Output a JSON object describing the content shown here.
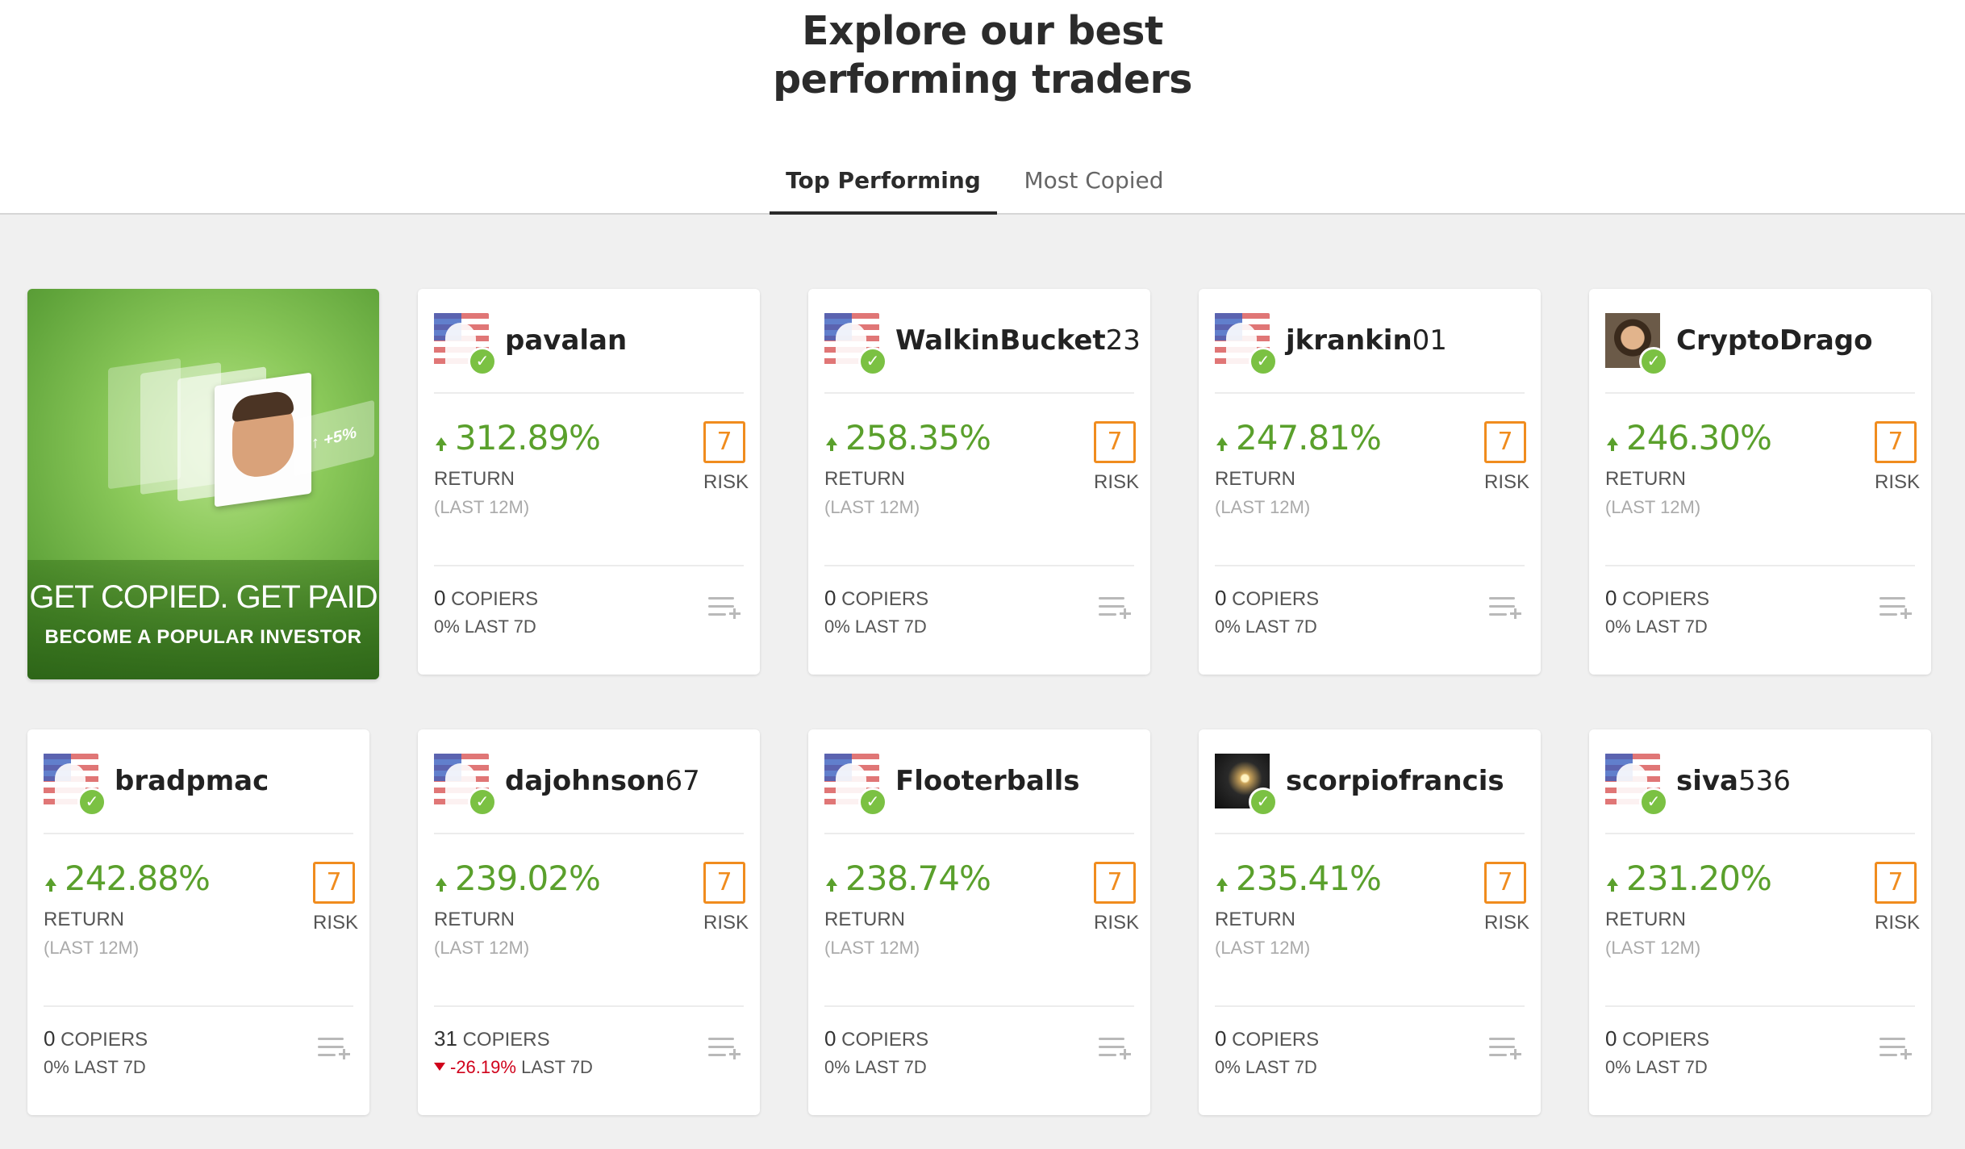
{
  "header": {
    "headline_line1": "Explore our best",
    "headline_line2": "performing traders"
  },
  "tabs": [
    {
      "label": "Top Performing",
      "active": true
    },
    {
      "label": "Most Copied",
      "active": false
    }
  ],
  "promo": {
    "title": "GET COPIED. GET PAID",
    "subtitle": "BECOME A POPULAR INVESTOR",
    "tag": "+5%"
  },
  "labels": {
    "return": "RETURN",
    "period": "(LAST 12M)",
    "risk": "RISK",
    "copiers": "COPIERS",
    "last7": "LAST 7D"
  },
  "colors": {
    "positive": "#5aa02c",
    "negative": "#d0021b",
    "risk": "#f08c1e",
    "verified": "#7bc143"
  },
  "traders": [
    {
      "name_bold": "pavalan",
      "name_regular": "",
      "avatar": "flag-default",
      "return": "312.89%",
      "risk": "7",
      "copiers": "0",
      "last7": "0%",
      "last7_negative": false
    },
    {
      "name_bold": "WalkinBucket",
      "name_regular": "23",
      "avatar": "flag-default",
      "return": "258.35%",
      "risk": "7",
      "copiers": "0",
      "last7": "0%",
      "last7_negative": false
    },
    {
      "name_bold": "jkrankin",
      "name_regular": "01",
      "avatar": "flag-default",
      "return": "247.81%",
      "risk": "7",
      "copiers": "0",
      "last7": "0%",
      "last7_negative": false
    },
    {
      "name_bold": "CryptoDrago",
      "name_regular": "",
      "avatar": "photo-portrait",
      "return": "246.30%",
      "risk": "7",
      "copiers": "0",
      "last7": "0%",
      "last7_negative": false
    },
    {
      "name_bold": "bradpmac",
      "name_regular": "",
      "avatar": "flag-default",
      "return": "242.88%",
      "risk": "7",
      "copiers": "0",
      "last7": "0%",
      "last7_negative": false
    },
    {
      "name_bold": "dajohnson",
      "name_regular": "67",
      "avatar": "flag-default",
      "return": "239.02%",
      "risk": "7",
      "copiers": "31",
      "last7": "-26.19%",
      "last7_negative": true
    },
    {
      "name_bold": "Flooterballs",
      "name_regular": "",
      "avatar": "flag-default",
      "return": "238.74%",
      "risk": "7",
      "copiers": "0",
      "last7": "0%",
      "last7_negative": false
    },
    {
      "name_bold": "scorpiofrancis",
      "name_regular": "",
      "avatar": "photo-dark",
      "return": "235.41%",
      "risk": "7",
      "copiers": "0",
      "last7": "0%",
      "last7_negative": false
    },
    {
      "name_bold": "siva",
      "name_regular": "536",
      "avatar": "flag-default",
      "return": "231.20%",
      "risk": "7",
      "copiers": "0",
      "last7": "0%",
      "last7_negative": false
    }
  ]
}
